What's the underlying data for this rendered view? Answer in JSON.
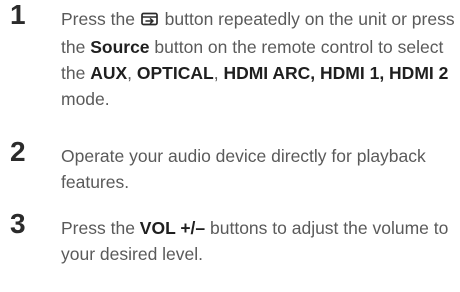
{
  "steps": [
    {
      "number": "1",
      "parts": {
        "a": "Press the ",
        "icon": "source-icon",
        "b": " button repeatedly on the unit or press the ",
        "source": "Source",
        "c": " button on the remote control to select the ",
        "aux": "AUX",
        "sep1": ", ",
        "optical": "OPTICAL",
        "sep2": ", ",
        "hdmi_modes": "HDMI ARC, HDMI 1, HDMI 2",
        "d": " mode."
      }
    },
    {
      "number": "2",
      "text": "Operate your audio device directly for playback features."
    },
    {
      "number": "3",
      "parts": {
        "a": "Press the ",
        "vol": "VOL +/–",
        "b": " buttons to adjust the volume to your desired level."
      }
    }
  ]
}
